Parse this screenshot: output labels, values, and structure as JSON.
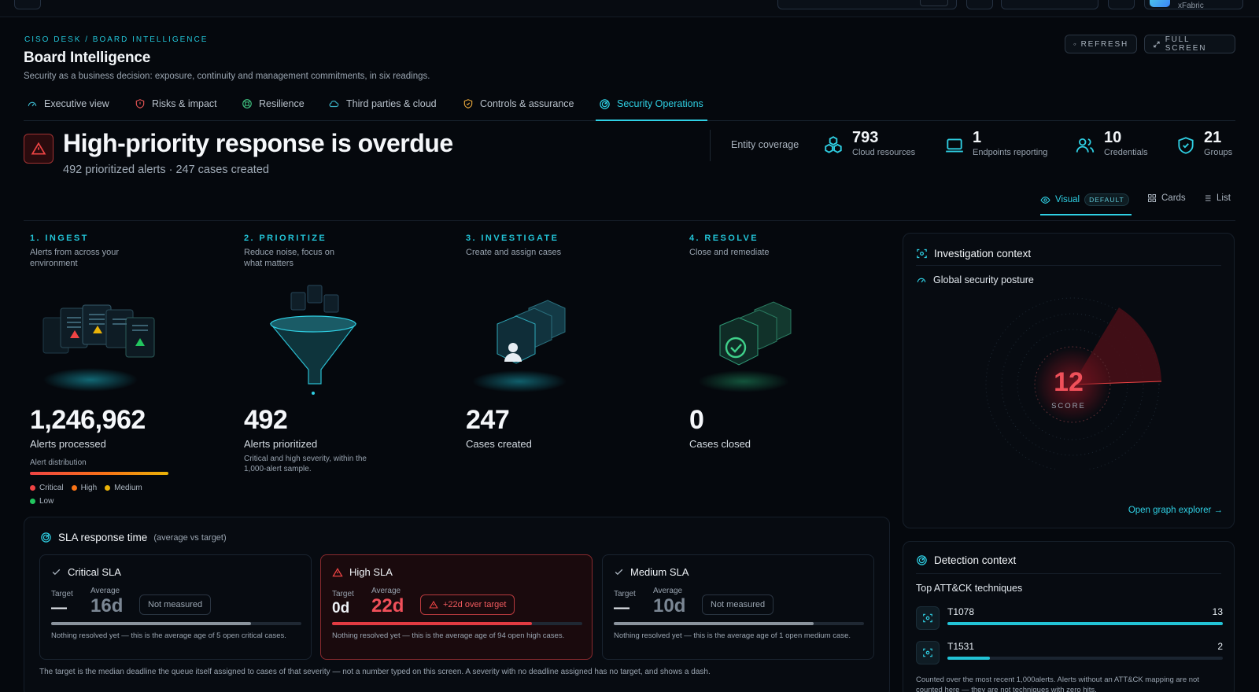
{
  "topbar": {
    "account_label": "xFabric"
  },
  "header": {
    "breadcrumb": "CISO DESK / BOARD INTELLIGENCE",
    "title": "Board Intelligence",
    "subtitle": "Security as a business decision: exposure, continuity and management commitments, in six readings.",
    "refresh_label": "REFRESH",
    "fullscreen_label": "FULL SCREEN"
  },
  "tabs": [
    {
      "label": "Executive view",
      "icon": "gauge-icon"
    },
    {
      "label": "Risks & impact",
      "icon": "shield-alert-icon"
    },
    {
      "label": "Resilience",
      "icon": "lifebuoy-icon"
    },
    {
      "label": "Third parties & cloud",
      "icon": "cloud-icon"
    },
    {
      "label": "Controls & assurance",
      "icon": "shield-check-icon"
    },
    {
      "label": "Security Operations",
      "icon": "radar-icon",
      "active": true
    }
  ],
  "alert": {
    "headline": "High-priority response is overdue",
    "subline": "492 prioritized alerts · 247 cases created"
  },
  "coverage": {
    "label": "Entity coverage",
    "items": [
      {
        "value": "793",
        "label": "Cloud resources",
        "icon": "cubes-icon"
      },
      {
        "value": "1",
        "label": "Endpoints reporting",
        "icon": "laptop-icon"
      },
      {
        "value": "10",
        "label": "Credentials",
        "icon": "users-icon"
      },
      {
        "value": "21",
        "label": "Groups",
        "icon": "shield-icon"
      }
    ]
  },
  "view_switch": {
    "visual": "Visual",
    "default_badge": "DEFAULT",
    "cards": "Cards",
    "list": "List"
  },
  "pipeline": [
    {
      "step": "1. INGEST",
      "desc": "Alerts from across your environment",
      "value": "1,246,962",
      "label": "Alerts processed"
    },
    {
      "step": "2. PRIORITIZE",
      "desc": "Reduce noise, focus on what matters",
      "value": "492",
      "label": "Alerts prioritized",
      "note": "Critical and high severity, within the 1,000-alert sample."
    },
    {
      "step": "3. INVESTIGATE",
      "desc": "Create and assign cases",
      "value": "247",
      "label": "Cases created"
    },
    {
      "step": "4. RESOLVE",
      "desc": "Close and remediate",
      "value": "0",
      "label": "Cases closed"
    }
  ],
  "distribution": {
    "title": "Alert distribution",
    "legend": [
      {
        "label": "Critical",
        "color": "#ef4444"
      },
      {
        "label": "High",
        "color": "#f97316"
      },
      {
        "label": "Medium",
        "color": "#eab308"
      },
      {
        "label": "Low",
        "color": "#22c55e"
      }
    ]
  },
  "investigation": {
    "title": "Investigation context",
    "subtitle": "Global security posture",
    "score": "12",
    "score_label": "SCORE",
    "link": "Open graph explorer →"
  },
  "sla": {
    "title": "SLA response time",
    "subtitle": "(average vs target)",
    "target_label": "Target",
    "average_label": "Average",
    "cards": [
      {
        "name": "Critical SLA",
        "target": "—",
        "average": "16d",
        "status": "Not measured",
        "progress": 0.8,
        "note": "Nothing resolved yet — this is the average age of 5 open critical cases."
      },
      {
        "name": "High SLA",
        "target": "0d",
        "average": "22d",
        "status": "+22d over target",
        "progress": 0.8,
        "note": "Nothing resolved yet — this is the average age of 94 open high cases."
      },
      {
        "name": "Medium SLA",
        "target": "—",
        "average": "10d",
        "status": "Not measured",
        "progress": 0.8,
        "note": "Nothing resolved yet — this is the average age of 1 open medium case."
      }
    ],
    "footnote": "The target is the median deadline the queue itself assigned to cases of that severity — not a number typed on this screen. A severity with no deadline assigned has no target, and shows a dash."
  },
  "detection": {
    "title": "Detection context",
    "subtitle": "Top ATT&CK techniques",
    "techniques": [
      {
        "id": "T1078",
        "count": "13",
        "fraction": 1.0
      },
      {
        "id": "T1531",
        "count": "2",
        "fraction": 0.154
      }
    ],
    "footnote": "Counted over the most recent 1,000alerts. Alerts without an ATT&CK mapping are not counted here — they are not techniques with zero hits."
  }
}
